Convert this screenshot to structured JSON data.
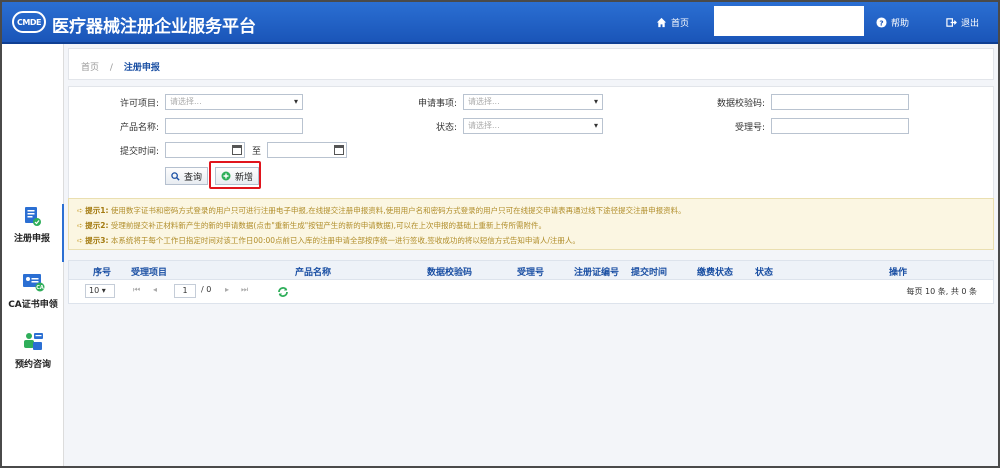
{
  "header": {
    "logo_text": "CMDE",
    "title": "医疗器械注册企业服务平台",
    "nav": [
      {
        "label": "首页",
        "icon": "home-icon"
      },
      {
        "label": "帮助",
        "icon": "help-icon"
      },
      {
        "label": "退出",
        "icon": "logout-icon"
      }
    ]
  },
  "sidebar": {
    "items": [
      {
        "label": "注册申报",
        "icon": "registration-icon",
        "active": true
      },
      {
        "label": "CA证书申领",
        "icon": "ca-certificate-icon",
        "active": false
      },
      {
        "label": "预约咨询",
        "icon": "consult-icon",
        "active": false
      }
    ]
  },
  "breadcrumb": {
    "home": "首页",
    "sep": "/",
    "current": "注册申报"
  },
  "form": {
    "license_item": {
      "label": "许可项目:",
      "placeholder": "请选择..."
    },
    "application_type": {
      "label": "申请事项:",
      "placeholder": "请选择..."
    },
    "checksum": {
      "label": "数据校验码:",
      "value": ""
    },
    "product_name": {
      "label": "产品名称:",
      "value": ""
    },
    "status": {
      "label": "状态:",
      "placeholder": "请选择..."
    },
    "acceptance_no": {
      "label": "受理号:",
      "value": ""
    },
    "submit_time": {
      "label": "提交时间:",
      "to": "至"
    },
    "query_label": "查询",
    "add_label": "新增"
  },
  "tips": [
    {
      "title": "提示1:",
      "text": "使用数字证书和密码方式登录的用户只可进行注册电子申报,在线提交注册申报资料,使用用户名和密码方式登录的用户只可在线提交申请表再通过线下途径提交注册申报资料。"
    },
    {
      "title": "提示2:",
      "text": "受理前提交补正材料新产生的新的申请数据(点击\"重新生成\"按钮产生的新的申请数据),可以在上次申报的基础上重新上传所需附件。"
    },
    {
      "title": "提示3:",
      "text": "本系统将于每个工作日指定时间对该工作日00:00点前已入库的注册申请全部按序统一进行签收,签收成功的将以短信方式告知申请人/注册人。"
    }
  ],
  "table": {
    "columns": [
      "序号",
      "受理项目",
      "产品名称",
      "数据校验码",
      "受理号",
      "注册证编号",
      "提交时间",
      "缴费状态",
      "状态",
      "操作"
    ]
  },
  "pager": {
    "page_size": "10",
    "current_page": "1",
    "total_pages": "/ 0",
    "summary": "每页 10 条, 共 0 条"
  },
  "colors": {
    "header": "#1a55b8",
    "accent": "#1a4fa3",
    "highlight": "#e0141c",
    "tips_bg": "#fbf6e2"
  }
}
